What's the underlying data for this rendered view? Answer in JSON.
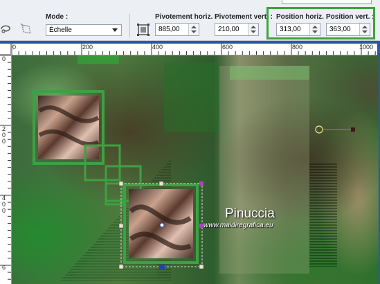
{
  "toolbar": {
    "mode_label": "Mode :",
    "mode_value": "Échelle",
    "pivot_h_label": "Pivotement horiz. :",
    "pivot_h_value": "885,00",
    "pivot_v_label": "Pivotement vert. :",
    "pivot_v_value": "210,00",
    "pos_h_label": "Position horiz. :",
    "pos_h_value": "313,00",
    "pos_v_label": "Position vert. :",
    "pos_v_value": "363,00",
    "icons": [
      "lasso-icon",
      "deform-icon",
      "pick-tool-icon"
    ],
    "highlight_color": "#3aa53a"
  },
  "ruler": {
    "h_labels": [
      "0",
      "200",
      "400",
      "600",
      "800",
      "1000"
    ],
    "v_labels": [
      "0",
      "2\n0\n0",
      "4\n0\n0",
      "6"
    ]
  },
  "canvas": {
    "watermark_title": "Pinuccia",
    "watermark_url": "www.maidiregrafica.eu",
    "frame_color": "#3fa043"
  }
}
